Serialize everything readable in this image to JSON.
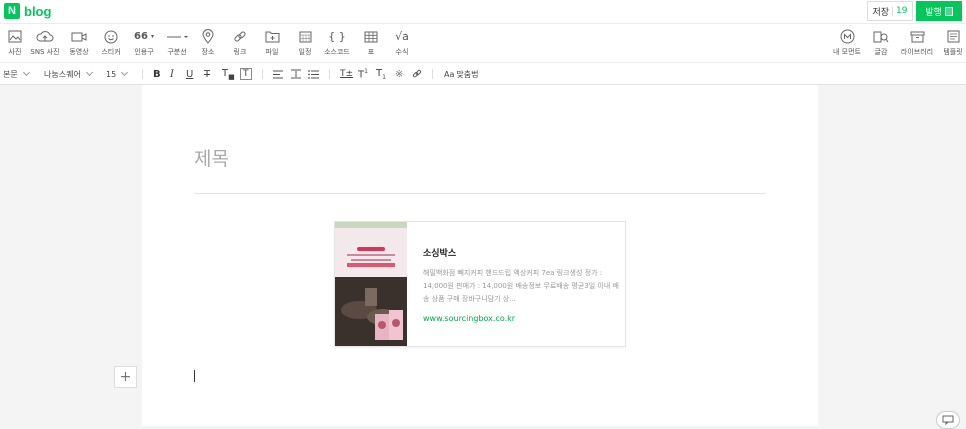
{
  "header": {
    "logo_mark": "N",
    "logo_text": "blog",
    "save_label": "저장",
    "save_count": "19",
    "publish_label": "발행"
  },
  "toolbar": {
    "left_items": [
      {
        "label": "사진",
        "icon": "photo-icon"
      },
      {
        "label": "SNS 사진",
        "icon": "cloud-icon"
      },
      {
        "label": "동영상",
        "icon": "video-icon"
      },
      {
        "label": "스티커",
        "icon": "smile-icon"
      },
      {
        "label": "인용구",
        "icon": "quote-icon",
        "glyph": "66"
      },
      {
        "label": "구분선",
        "icon": "divider-icon"
      },
      {
        "label": "장소",
        "icon": "location-pin-icon"
      },
      {
        "label": "링크",
        "icon": "link-icon"
      },
      {
        "label": "파일",
        "icon": "file-icon"
      },
      {
        "label": "일정",
        "icon": "calendar-icon"
      },
      {
        "label": "소스코드",
        "icon": "code-braces-icon",
        "glyph": "{ }"
      },
      {
        "label": "표",
        "icon": "table-icon"
      },
      {
        "label": "수식",
        "icon": "formula-icon",
        "glyph": "√a"
      }
    ],
    "right_items": [
      {
        "label": "내 모먼트",
        "icon": "moment-icon",
        "glyph": "M"
      },
      {
        "label": "글감",
        "icon": "material-search-icon"
      },
      {
        "label": "라이브러리",
        "icon": "library-icon"
      },
      {
        "label": "템플릿",
        "icon": "template-icon"
      }
    ]
  },
  "format": {
    "paragraph_style": "본문",
    "font_family": "나눔스퀘어",
    "font_size": "15",
    "spellcheck_label": "맞춤법",
    "spellcheck_glyph": "Aa"
  },
  "editor": {
    "title_placeholder": "제목",
    "add_glyph": "+"
  },
  "og_card": {
    "title": "소싱박스",
    "description": "해밀백화점 빼지커피 핸드드립 액상커피 7ea 링크생성 정가 : 14,000원 판매가 : 14,000원 배송정보 무료배송 평균3일 이내 배송 상품 구매 장바구니담기 상...",
    "url": "www.sourcingbox.co.kr"
  },
  "colors": {
    "brand": "#03c75a",
    "url_green": "#03a94c"
  }
}
